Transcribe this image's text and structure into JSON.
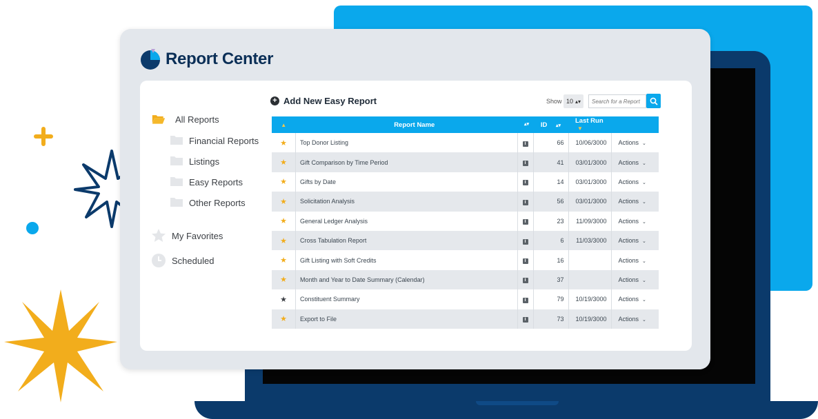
{
  "app": {
    "title": "Report Center"
  },
  "sidebar": {
    "items": [
      {
        "label": "All Reports",
        "icon": "open-folder-icon"
      },
      {
        "label": "Financial Reports",
        "icon": "folder-icon"
      },
      {
        "label": "Listings",
        "icon": "folder-icon"
      },
      {
        "label": "Easy Reports",
        "icon": "folder-icon"
      },
      {
        "label": "Other Reports",
        "icon": "folder-icon"
      },
      {
        "label": "My Favorites",
        "icon": "star-icon"
      },
      {
        "label": "Scheduled",
        "icon": "clock-icon"
      }
    ]
  },
  "toolbar": {
    "add_label": "Add New Easy Report",
    "show_label": "Show",
    "show_value": "10",
    "search_placeholder": "Search for a Report"
  },
  "table": {
    "headers": {
      "name": "Report Name",
      "id": "ID",
      "last_run": "Last Run"
    },
    "rows": [
      {
        "favorite": true,
        "name": "Top Donor Listing",
        "id": "66",
        "last_run": "10/06/3000",
        "actions": "Actions"
      },
      {
        "favorite": true,
        "name": "Gift Comparison by Time Period",
        "id": "41",
        "last_run": "03/01/3000",
        "actions": "Actions"
      },
      {
        "favorite": true,
        "name": "Gifts by Date",
        "id": "14",
        "last_run": "03/01/3000",
        "actions": "Actions"
      },
      {
        "favorite": true,
        "name": "Solicitation Analysis",
        "id": "56",
        "last_run": "03/01/3000",
        "actions": "Actions"
      },
      {
        "favorite": true,
        "name": "General Ledger Analysis",
        "id": "23",
        "last_run": "11/09/3000",
        "actions": "Actions"
      },
      {
        "favorite": true,
        "name": "Cross Tabulation Report",
        "id": "6",
        "last_run": "11/03/3000",
        "actions": "Actions"
      },
      {
        "favorite": true,
        "name": "Gift Listing with Soft Credits",
        "id": "16",
        "last_run": "",
        "actions": "Actions"
      },
      {
        "favorite": true,
        "name": "Month and Year to Date Summary (Calendar)",
        "id": "37",
        "last_run": "",
        "actions": "Actions"
      },
      {
        "favorite": false,
        "name": "Constituent Summary",
        "id": "79",
        "last_run": "10/19/3000",
        "actions": "Actions"
      },
      {
        "favorite": true,
        "name": "Export to File",
        "id": "73",
        "last_run": "10/19/3000",
        "actions": "Actions"
      }
    ]
  },
  "colors": {
    "accent_blue": "#0aa8ec",
    "navy": "#0b3a6b",
    "gold": "#f2ad1c"
  }
}
